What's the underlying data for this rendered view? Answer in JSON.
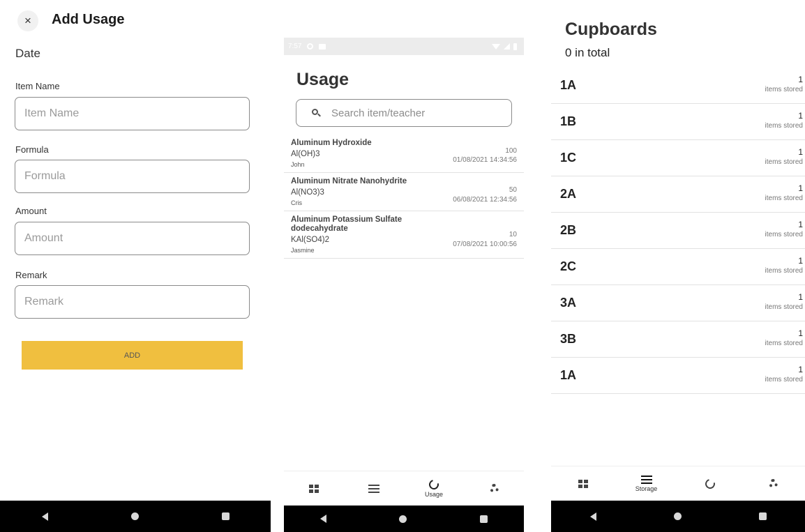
{
  "add_usage": {
    "title": "Add Usage",
    "close_icon": "close-icon",
    "date_label": "Date",
    "fields": [
      {
        "label": "Item Name",
        "placeholder": "Item Name",
        "value": ""
      },
      {
        "label": "Formula",
        "placeholder": "Formula",
        "value": ""
      },
      {
        "label": "Amount",
        "placeholder": "Amount",
        "value": ""
      },
      {
        "label": "Remark",
        "placeholder": "Remark",
        "value": ""
      }
    ],
    "add_button": "ADD",
    "accent_color": "#f0bf3f"
  },
  "usage": {
    "status_time": "7:57",
    "title": "Usage",
    "search_placeholder": "Search item/teacher",
    "items": [
      {
        "name": "Aluminum Hydroxide",
        "formula": "Al(OH)3",
        "teacher": "John",
        "amount": "100",
        "datetime": "01/08/2021 14:34:56"
      },
      {
        "name": "Aluminum Nitrate Nanohydrite",
        "formula": "Al(NO3)3",
        "teacher": "Cris",
        "amount": "50",
        "datetime": "06/08/2021 12:34:56"
      },
      {
        "name": "Aluminum Potassium Sulfate dodecahydrate",
        "formula": "KAl(SO4)2",
        "teacher": "Jasmine",
        "amount": "10",
        "datetime": "07/08/2021 10:00:56"
      }
    ],
    "tabs": [
      {
        "icon": "dashboard-icon",
        "label": ""
      },
      {
        "icon": "list-icon",
        "label": ""
      },
      {
        "icon": "usage-circle-icon",
        "label": "Usage"
      },
      {
        "icon": "gear-icon",
        "label": ""
      }
    ]
  },
  "cupboards": {
    "title": "Cupboards",
    "total": "0 in total",
    "items": [
      {
        "name": "1A",
        "count": "1",
        "unit": "items stored"
      },
      {
        "name": "1B",
        "count": "1",
        "unit": "items stored"
      },
      {
        "name": "1C",
        "count": "1",
        "unit": "items stored"
      },
      {
        "name": "2A",
        "count": "1",
        "unit": "items stored"
      },
      {
        "name": "2B",
        "count": "1",
        "unit": "items stored"
      },
      {
        "name": "2C",
        "count": "1",
        "unit": "items stored"
      },
      {
        "name": "3A",
        "count": "1",
        "unit": "items stored"
      },
      {
        "name": "3B",
        "count": "1",
        "unit": "items stored"
      },
      {
        "name": "1A",
        "count": "1",
        "unit": "items stored"
      }
    ],
    "tabs": [
      {
        "icon": "dashboard-icon",
        "label": ""
      },
      {
        "icon": "list-icon",
        "label": "Storage"
      },
      {
        "icon": "usage-circle-icon",
        "label": ""
      },
      {
        "icon": "gear-icon",
        "label": ""
      }
    ]
  },
  "system_nav": {
    "back_icon": "back-icon",
    "home_icon": "home-icon",
    "recents_icon": "recents-icon"
  }
}
